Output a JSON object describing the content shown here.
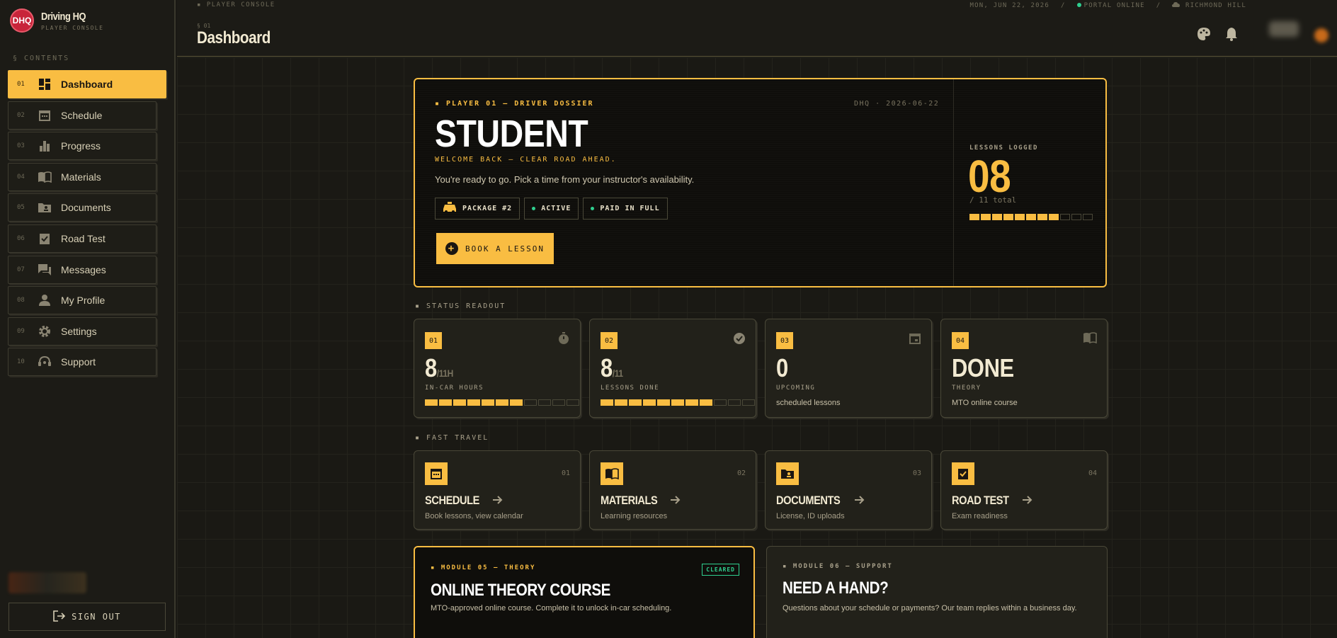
{
  "app": {
    "logo_text": "DHQ",
    "title": "Driving HQ",
    "subtitle": "PLAYER CONSOLE"
  },
  "sidebar": {
    "contents_label": "§ CONTENTS",
    "items": [
      {
        "num": "01",
        "label": "Dashboard",
        "icon": "dashboard-icon"
      },
      {
        "num": "02",
        "label": "Schedule",
        "icon": "calendar-icon"
      },
      {
        "num": "03",
        "label": "Progress",
        "icon": "bar-chart-icon"
      },
      {
        "num": "04",
        "label": "Materials",
        "icon": "book-icon"
      },
      {
        "num": "05",
        "label": "Documents",
        "icon": "folder-user-icon"
      },
      {
        "num": "06",
        "label": "Road Test",
        "icon": "clipboard-check-icon"
      },
      {
        "num": "07",
        "label": "Messages",
        "icon": "chat-icon"
      },
      {
        "num": "08",
        "label": "My Profile",
        "icon": "person-icon"
      },
      {
        "num": "09",
        "label": "Settings",
        "icon": "gear-icon"
      },
      {
        "num": "10",
        "label": "Support",
        "icon": "support-icon"
      }
    ],
    "signout_label": "SIGN OUT"
  },
  "topbar": {
    "crumb": "▪ PLAYER CONSOLE",
    "date": "MON, JUN 22, 2026",
    "sep": "/",
    "portal_status": "PORTAL ONLINE",
    "location": "RICHMOND HILL",
    "page_num": "§ 01",
    "page_title": "Dashboard"
  },
  "hero": {
    "tag": "▪ PLAYER 01 — DRIVER DOSSIER",
    "date_code": "DHQ · 2026-06-22",
    "title": "STUDENT",
    "welcome": "WELCOME BACK — CLEAR ROAD AHEAD.",
    "description": "You're ready to go. Pick a time from your instructor's availability.",
    "chips": {
      "package": "PACKAGE #2",
      "status": "ACTIVE",
      "payment": "PAID IN FULL"
    },
    "book_label": "BOOK A LESSON",
    "lessons_label": "LESSONS LOGGED",
    "lessons_count": "08",
    "lessons_total": "/ 11 total",
    "lessons_done": 8,
    "lessons_max": 11
  },
  "status_readout": {
    "label": "▪ STATUS READOUT",
    "cards": [
      {
        "num": "01",
        "value": "8",
        "suffix": "/11H",
        "sub": "IN-CAR HOURS",
        "icon": "timer-icon",
        "filled": 7,
        "total": 11
      },
      {
        "num": "02",
        "value": "8",
        "suffix": "/11",
        "sub": "LESSONS DONE",
        "icon": "check-circle-icon",
        "filled": 8,
        "total": 11
      },
      {
        "num": "03",
        "value": "0",
        "suffix": "",
        "sub": "UPCOMING",
        "desc": "scheduled lessons",
        "icon": "event-icon"
      },
      {
        "num": "04",
        "value": "DONE",
        "suffix": "",
        "sub": "THEORY",
        "desc": "MTO online course",
        "icon": "book-open-icon"
      }
    ]
  },
  "fast_travel": {
    "label": "▪ FAST TRAVEL",
    "cards": [
      {
        "num": "01",
        "title": "SCHEDULE",
        "desc": "Book lessons, view calendar"
      },
      {
        "num": "02",
        "title": "MATERIALS",
        "desc": "Learning resources"
      },
      {
        "num": "03",
        "title": "DOCUMENTS",
        "desc": "License, ID uploads"
      },
      {
        "num": "04",
        "title": "ROAD TEST",
        "desc": "Exam readiness"
      }
    ]
  },
  "module_theory": {
    "tag": "▪ MODULE 05 — THEORY",
    "badge": "CLEARED",
    "title": "ONLINE THEORY COURSE",
    "desc": "MTO-approved online course. Complete it to unlock in-car scheduling."
  },
  "module_support": {
    "tag": "▪ MODULE 06 — SUPPORT",
    "title": "NEED A HAND?",
    "desc": "Questions about your schedule or payments? Our team replies within a business day."
  },
  "colors": {
    "accent": "#f9bd42",
    "background": "#1a1914",
    "success": "#2fcf8f",
    "logo_red": "#c8243a"
  }
}
